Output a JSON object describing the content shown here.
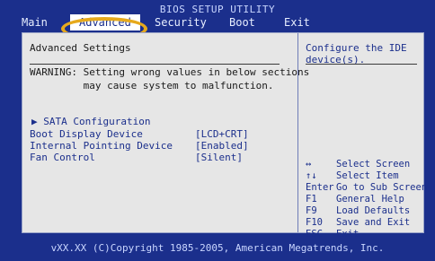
{
  "header": {
    "title": "BIOS SETUP UTILITY",
    "tabs": [
      "Main",
      "Advanced",
      "Security",
      "Boot",
      "Exit"
    ]
  },
  "main": {
    "section_title": "Advanced Settings",
    "warning": "WARNING: Setting wrong values in below sections\n         may cause system to malfunction.",
    "submenu": "▶ SATA Configuration",
    "settings": [
      {
        "label": "Boot Display Device",
        "value": "[LCD+CRT]"
      },
      {
        "label": "Internal Pointing Device",
        "value": "[Enabled]"
      },
      {
        "label": "Fan Control",
        "value": "[Silent]"
      }
    ]
  },
  "help": {
    "text": "Configure the IDE device(s).",
    "keys": [
      {
        "key": "↔",
        "desc": "Select Screen"
      },
      {
        "key": "↑↓",
        "desc": "Select Item"
      },
      {
        "key": "Enter",
        "desc": "Go to Sub Screen"
      },
      {
        "key": "F1",
        "desc": "General Help"
      },
      {
        "key": "F9",
        "desc": "Load Defaults"
      },
      {
        "key": "F10",
        "desc": "Save and Exit"
      },
      {
        "key": "ESC",
        "desc": "Exit"
      }
    ]
  },
  "footer": {
    "copyright": "vXX.XX (C)Copyright 1985-2005, American Megatrends, Inc."
  },
  "colors": {
    "background": "#1b2f8c",
    "panel": "#e6e6e6",
    "highlight": "#e6a91c"
  }
}
